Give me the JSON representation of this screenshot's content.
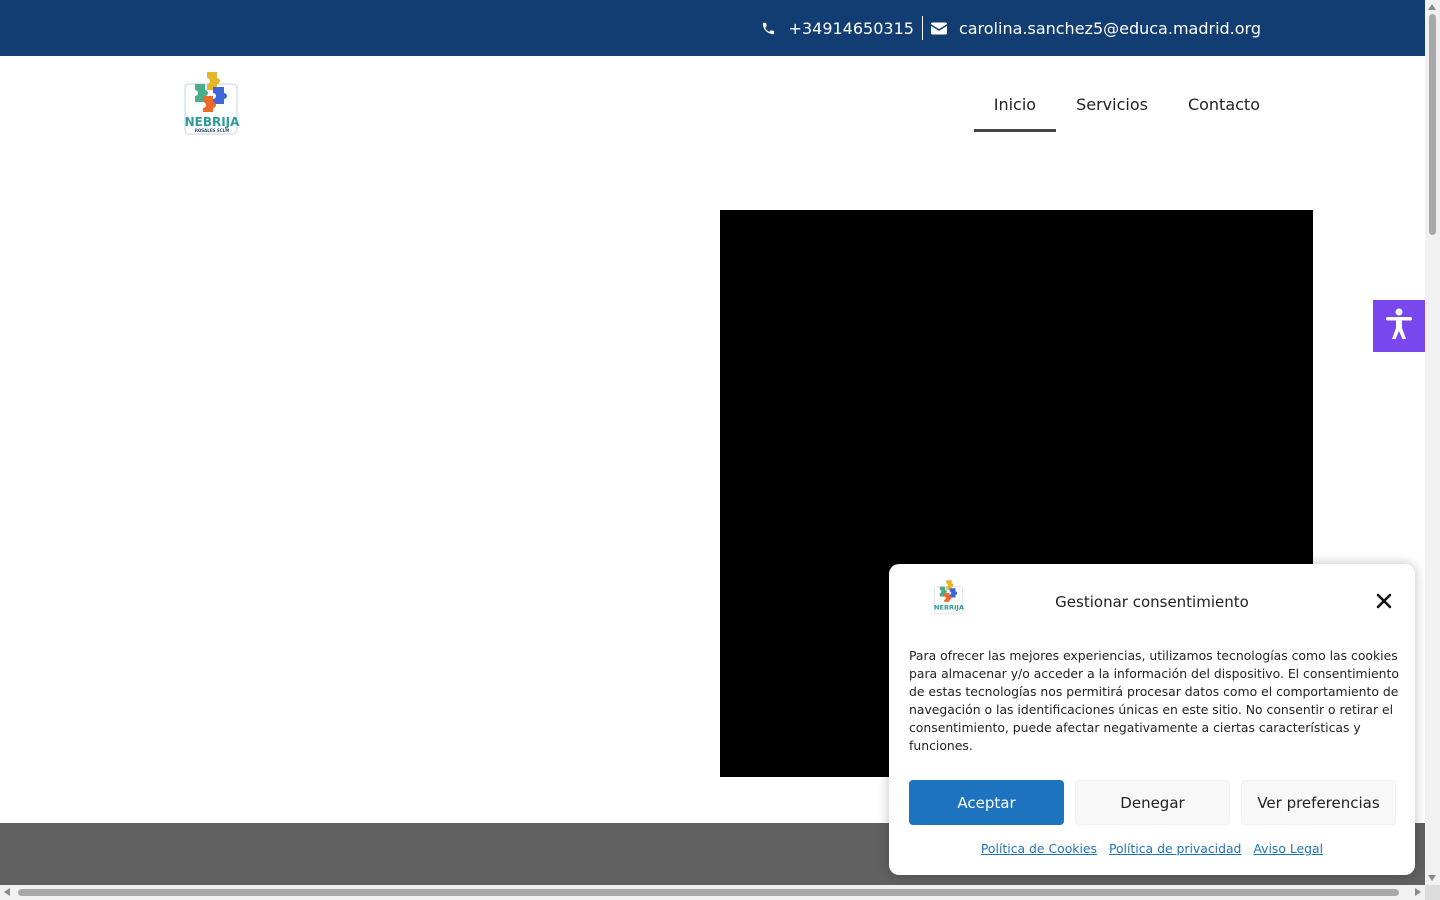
{
  "topbar": {
    "phone": "+34914650315",
    "email": "carolina.sanchez5@educa.madrid.org",
    "bg_color": "#123d73"
  },
  "header": {
    "logo_text": "NEBRIJA",
    "logo_subtext": "ROSALES SCLM",
    "nav": [
      {
        "label": "Inicio",
        "active": true
      },
      {
        "label": "Servicios",
        "active": false
      },
      {
        "label": "Contacto",
        "active": false
      }
    ]
  },
  "accessibility_button": {
    "icon": "accessibility-icon",
    "color": "#7a46ee"
  },
  "consent": {
    "title": "Gestionar consentimiento",
    "body": "Para ofrecer las mejores experiencias, utilizamos tecnologías como las cookies para almacenar y/o acceder a la información del dispositivo. El consentimiento de estas tecnologías nos permitirá procesar datos como el comportamiento de navegación o las identificaciones únicas en este sitio. No consentir o retirar el consentimiento, puede afectar negativamente a ciertas características y funciones.",
    "buttons": {
      "accept": "Aceptar",
      "deny": "Denegar",
      "preferences": "Ver preferencias"
    },
    "links": {
      "cookies": "Política de Cookies",
      "privacy": "Política de privacidad",
      "legal": "Aviso Legal"
    },
    "accent_color": "#1e73be"
  }
}
